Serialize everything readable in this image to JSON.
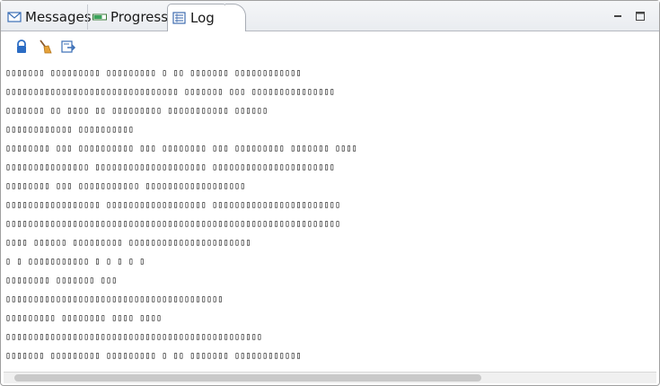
{
  "tabs": [
    {
      "label": "Messages",
      "icon": "envelope-icon"
    },
    {
      "label": "Progress",
      "icon": "progress-bar-icon"
    },
    {
      "label": "Log",
      "icon": "log-list-icon",
      "active": true
    }
  ],
  "window_controls": [
    "minimize-icon",
    "maximize-icon"
  ],
  "toolbar": [
    "lock-icon",
    "broom-clear-icon",
    "export-icon"
  ],
  "log_lines": [
    "▯▯▯▯▯▯▯ ▯▯▯▯▯▯▯▯▯ ▯▯▯▯▯▯▯▯▯ ▯ ▯▯ ▯▯▯▯▯▯▯ ▯▯▯▯▯▯▯▯▯▯▯▯",
    "▯▯▯▯▯▯▯▯▯▯▯▯▯▯▯▯▯▯▯▯▯▯▯▯▯▯▯▯▯▯▯ ▯▯▯▯▯▯▯ ▯▯▯ ▯▯▯▯▯▯▯▯▯▯▯▯▯▯▯",
    "▯▯▯▯▯▯▯ ▯▯ ▯▯▯▯ ▯▯ ▯▯▯▯▯▯▯▯▯ ▯▯▯▯▯▯▯▯▯▯▯ ▯▯▯▯▯▯",
    "▯▯▯▯▯▯▯▯▯▯▯▯ ▯▯▯▯▯▯▯▯▯▯",
    "▯▯▯▯▯▯▯▯ ▯▯▯ ▯▯▯▯▯▯▯▯▯▯ ▯▯▯ ▯▯▯▯▯▯▯▯ ▯▯▯ ▯▯▯▯▯▯▯▯▯ ▯▯▯▯▯▯▯ ▯▯▯▯",
    "▯▯▯▯▯▯▯▯▯▯▯▯▯▯▯ ▯▯▯▯▯▯▯▯▯▯▯▯▯▯▯▯▯▯▯▯ ▯▯▯▯▯▯▯▯▯▯▯▯▯▯▯▯▯▯▯▯▯▯",
    "▯▯▯▯▯▯▯▯ ▯▯▯ ▯▯▯▯▯▯▯▯▯▯▯ ▯▯▯▯▯▯▯▯▯▯▯▯▯▯▯▯▯▯",
    "▯▯▯▯▯▯▯▯▯▯▯▯▯▯▯▯▯ ▯▯▯▯▯▯▯▯▯▯▯▯▯▯▯▯▯▯ ▯▯▯▯▯▯▯▯▯▯▯▯▯▯▯▯▯▯▯▯▯▯▯",
    "▯▯▯▯▯▯▯▯▯▯▯▯▯▯▯▯▯▯▯▯▯▯▯▯▯▯▯▯▯▯▯▯▯▯▯▯▯▯▯▯▯▯▯▯▯▯▯▯▯▯▯▯▯▯▯▯▯▯▯▯",
    "▯▯▯▯ ▯▯▯▯▯▯ ▯▯▯▯▯▯▯▯▯ ▯▯▯▯▯▯▯▯▯▯▯▯▯▯▯▯▯▯▯▯▯▯",
    "▯ ▯ ▯▯▯▯▯▯▯▯▯▯▯ ▯ ▯ ▯ ▯ ▯",
    "▯▯▯▯▯▯▯▯ ▯▯▯▯▯▯▯ ▯▯▯",
    "▯▯▯▯▯▯▯▯▯▯▯▯▯▯▯▯▯▯▯▯▯▯▯▯▯▯▯▯▯▯▯▯▯▯▯▯▯▯▯",
    "▯▯▯▯▯▯▯▯▯ ▯▯▯▯▯▯▯▯ ▯▯▯▯ ▯▯▯▯",
    "▯▯▯▯▯▯▯▯▯▯▯▯▯▯▯▯▯▯▯▯▯▯▯▯▯▯▯▯▯▯▯▯▯▯▯▯▯▯▯▯▯▯▯▯▯▯",
    "▯▯▯▯▯▯▯ ▯▯▯▯▯▯▯▯▯ ▯▯▯▯▯▯▯▯▯ ▯ ▯▯ ▯▯▯▯▯▯▯ ▯▯▯▯▯▯▯▯▯▯▯▯",
    "▯▯▯▯▯▯▯▯▯▯▯▯▯▯▯▯▯▯▯▯▯▯▯▯▯▯▯▯▯▯▯▯▯▯▯▯▯▯▯▯▯▯▯▯▯▯▯▯▯▯▯▯▯▯▯▯▯"
  ]
}
